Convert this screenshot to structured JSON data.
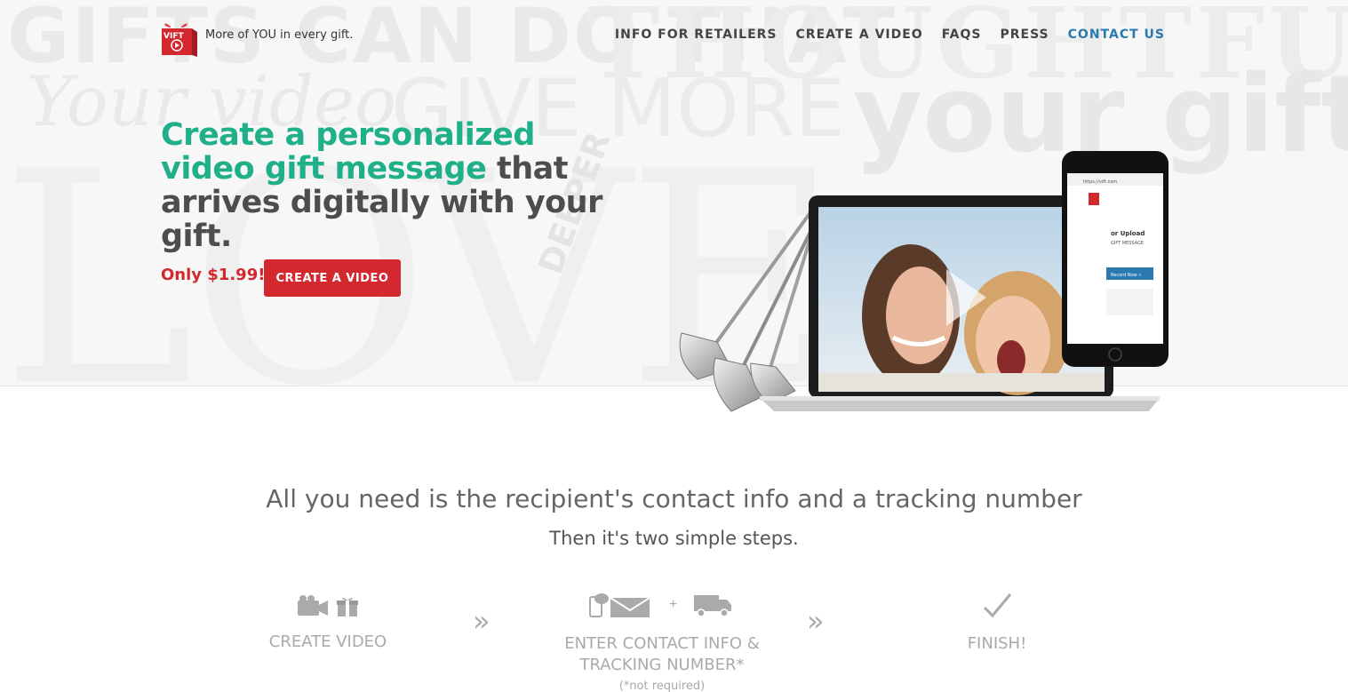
{
  "brand": {
    "logo_text": "VIFT",
    "tagline": "More of YOU in every gift."
  },
  "nav": [
    {
      "label": "INFO FOR RETAILERS"
    },
    {
      "label": "CREATE A VIDEO"
    },
    {
      "label": "FAQS"
    },
    {
      "label": "PRESS"
    },
    {
      "label": "CONTACT US"
    }
  ],
  "background_words": [
    "GIFTS CAN DO THAT",
    "THOUGHTFUL",
    "Your video",
    "GIVE MORE",
    "your gift",
    "LOVE",
    "DEEPER"
  ],
  "hero": {
    "headline_green": "Create a personalized video gift message",
    "headline_rest": " that arrives digitally with your gift.",
    "price": "Only $1.99!",
    "cta_label": "CREATE A VIDEO"
  },
  "phone_screen": {
    "url": "https://vift.com",
    "line1": "or Upload",
    "line2": "GIFT MESSAGE",
    "button": "Record Now »"
  },
  "steps_section": {
    "lead": "All you need is the recipient's contact info and a tracking number",
    "sub": "Then it's two simple steps.",
    "plus": "+",
    "separator": "»",
    "steps": [
      {
        "label": "CREATE VIDEO",
        "icons": [
          "video-camera-icon",
          "gift-icon"
        ]
      },
      {
        "label": "ENTER CONTACT INFO & TRACKING NUMBER*",
        "note": "(*not required)",
        "icons": [
          "sms-phone-icon",
          "envelope-icon",
          "delivery-truck-icon"
        ]
      },
      {
        "label": "FINISH!",
        "icons": [
          "checkmark-icon"
        ]
      }
    ]
  },
  "colors": {
    "accent_green": "#1fb08a",
    "accent_red": "#d4282f",
    "nav_active": "#2a7ab0"
  }
}
